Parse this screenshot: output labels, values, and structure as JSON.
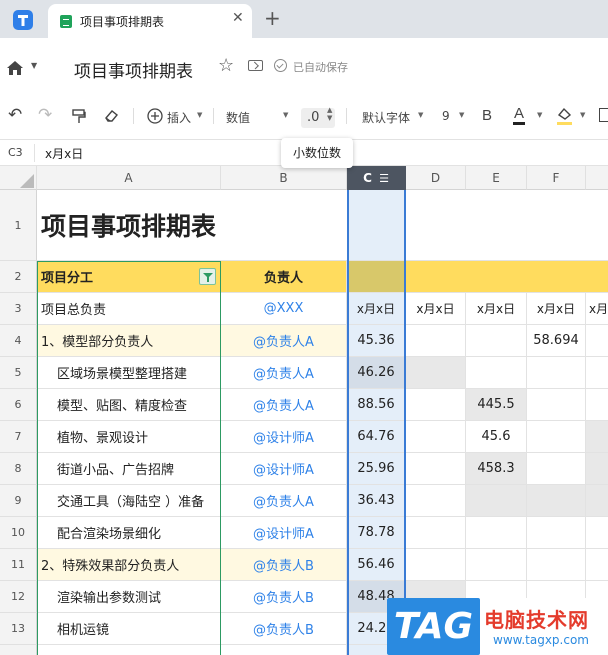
{
  "tab": {
    "title": "项目事项排期表"
  },
  "document": {
    "title": "项目事项排期表",
    "save_status": "已自动保存"
  },
  "toolbar": {
    "insert_label": "插入",
    "number_format": "数值",
    "decimal_value": ".0",
    "font_name": "默认字体",
    "font_size": "9",
    "bold_label": "B",
    "font_color_label": "A",
    "font_color": "#222222",
    "fill_color": "#ffdc5e",
    "tooltip": "小数位数"
  },
  "formula_bar": {
    "cell_ref": "C3",
    "value": "x月x日"
  },
  "columns": [
    "A",
    "B",
    "C",
    "D",
    "E",
    "F"
  ],
  "rows": {
    "r1": {
      "num": "1",
      "title": "项目事项排期表"
    },
    "r2": {
      "num": "2",
      "a": "项目分工",
      "b": "负责人"
    },
    "r3": {
      "num": "3",
      "a": "项目总负责",
      "b": "@XXX",
      "c": "x月x日",
      "d": "x月x日",
      "e": "x月x日",
      "f": "x月x日",
      "g": "x月"
    },
    "r4": {
      "num": "4",
      "a": "1、模型部分负责人",
      "b": "@负责人A",
      "c": "45.36",
      "f": "58.694"
    },
    "r5": {
      "num": "5",
      "a": "区域场景模型整理搭建",
      "b": "@负责人A",
      "c": "46.26"
    },
    "r6": {
      "num": "6",
      "a": "模型、贴图、精度检查",
      "b": "@负责人A",
      "c": "88.56",
      "e": "445.5"
    },
    "r7": {
      "num": "7",
      "a": "植物、景观设计",
      "b": "@设计师A",
      "c": "64.76",
      "e": "45.6"
    },
    "r8": {
      "num": "8",
      "a": "街道小品、广告招牌",
      "b": "@设计师A",
      "c": "25.96",
      "e": "458.3"
    },
    "r9": {
      "num": "9",
      "a": "交通工具（海陆空 ）准备",
      "b": "@负责人A",
      "c": "36.43"
    },
    "r10": {
      "num": "10",
      "a": "配合渲染场景细化",
      "b": "@设计师A",
      "c": "78.78"
    },
    "r11": {
      "num": "11",
      "a": "2、特殊效果部分负责人",
      "b": "@负责人B",
      "c": "56.46"
    },
    "r12": {
      "num": "12",
      "a": "渲染输出参数测试",
      "b": "@负责人B",
      "c": "48.48"
    },
    "r13": {
      "num": "13",
      "a": "相机运镜",
      "b": "@负责人B",
      "c": "24.29"
    }
  },
  "watermark": {
    "tag": "TAG",
    "title": "电脑技术网",
    "url": "www.tagxp.com"
  },
  "colors": {
    "accent_blue": "#2f82e8",
    "header_yellow": "#ffdc5e",
    "selection_border": "#3a7bd5",
    "filter_green": "#2d9a62"
  }
}
